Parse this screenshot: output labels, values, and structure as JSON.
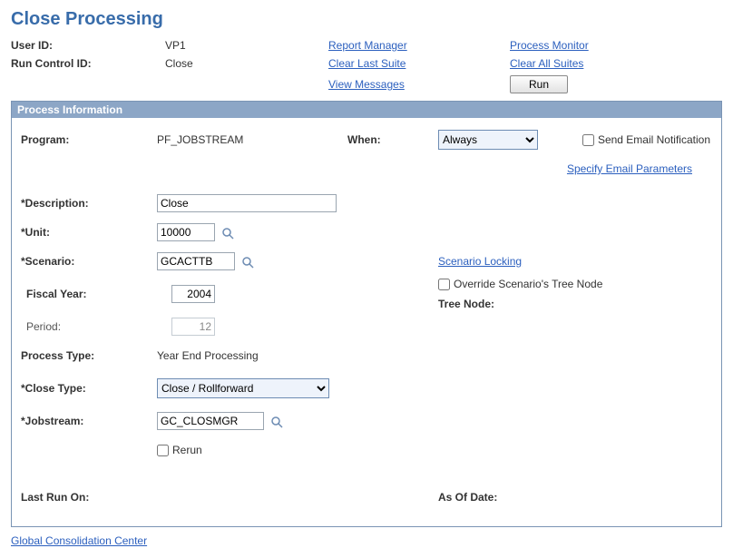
{
  "page_title": "Close Processing",
  "top": {
    "user_id_label": "User ID:",
    "user_id_value": "VP1",
    "run_control_label": "Run Control ID:",
    "run_control_value": "Close",
    "links": {
      "report_manager": "Report Manager",
      "clear_last_suite": "Clear Last Suite",
      "view_messages": "View Messages",
      "process_monitor": "Process Monitor",
      "clear_all_suites": "Clear All Suites"
    },
    "run_button": "Run"
  },
  "section_title": "Process Information",
  "form": {
    "program_label": "Program:",
    "program_value": "PF_JOBSTREAM",
    "when_label": "When:",
    "when_value": "Always",
    "send_email_label": "Send Email Notification",
    "specify_email_link": "Specify Email Parameters",
    "description_label": "*Description:",
    "description_value": "Close",
    "unit_label": "*Unit:",
    "unit_value": "10000",
    "scenario_label": "*Scenario:",
    "scenario_value": "GCACTTB",
    "scenario_locking_link": "Scenario Locking",
    "fiscal_year_label": "Fiscal Year:",
    "fiscal_year_value": "2004",
    "override_tree_label": "Override Scenario's Tree Node",
    "tree_node_label": "Tree Node:",
    "period_label": "Period:",
    "period_value": "12",
    "process_type_label": "Process Type:",
    "process_type_value": "Year End Processing",
    "close_type_label": "*Close Type:",
    "close_type_value": "Close / Rollforward",
    "jobstream_label": "*Jobstream:",
    "jobstream_value": "GC_CLOSMGR",
    "rerun_label": "Rerun",
    "last_run_label": "Last Run On:",
    "as_of_date_label": "As Of Date:"
  },
  "footer_link": "Global Consolidation Center"
}
